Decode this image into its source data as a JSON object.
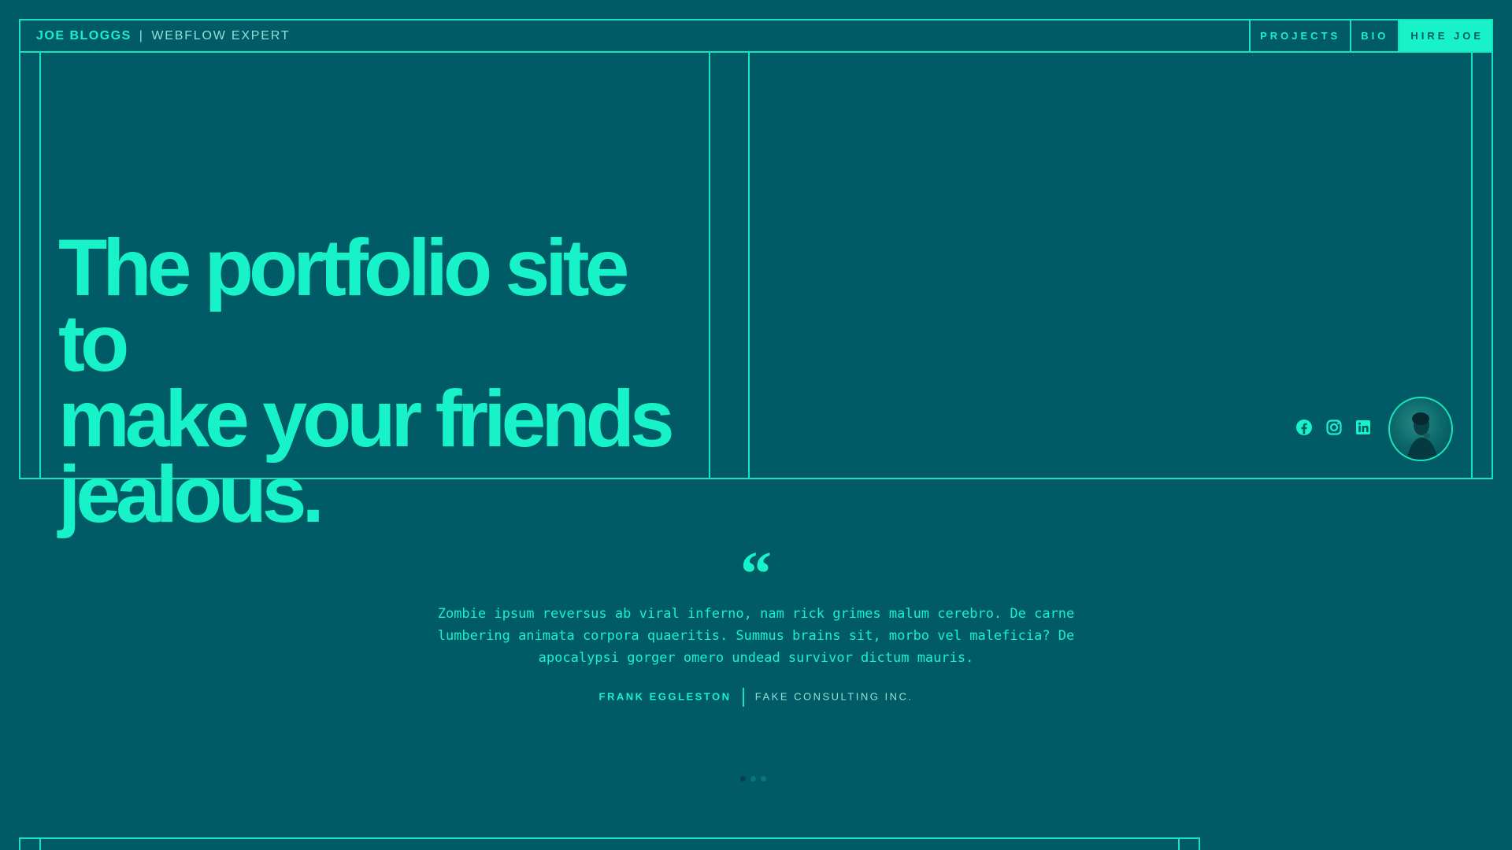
{
  "colors": {
    "background": "#015b67",
    "accent": "#17f2c9",
    "line": "#17e4bd",
    "muted": "#8fe0d6"
  },
  "header": {
    "brand_name": "JOE BLOGGS",
    "brand_separator": "|",
    "brand_role": "WEBFLOW EXPERT",
    "nav": [
      {
        "label": "PROJECTS"
      },
      {
        "label": "BIO"
      },
      {
        "label": "HIRE JOE"
      }
    ]
  },
  "hero": {
    "title_lines": [
      "The portfolio site to",
      "make your friends",
      "jealous."
    ],
    "socials": [
      {
        "icon": "facebook-icon"
      },
      {
        "icon": "instagram-icon"
      },
      {
        "icon": "linkedin-icon"
      }
    ],
    "avatar": "avatar"
  },
  "testimonial": {
    "quote_mark": "“",
    "text": "Zombie ipsum reversus ab viral inferno, nam rick grimes malum cerebro. De carne lumbering animata corpora quaeritis. Summus brains sit, morbo vel maleficia? De apocalypsi gorger omero undead survivor dictum mauris.",
    "author_name": "FRANK EGGLESTON",
    "author_company": "FAKE CONSULTING INC.",
    "slides": 3,
    "active_slide": 1
  }
}
